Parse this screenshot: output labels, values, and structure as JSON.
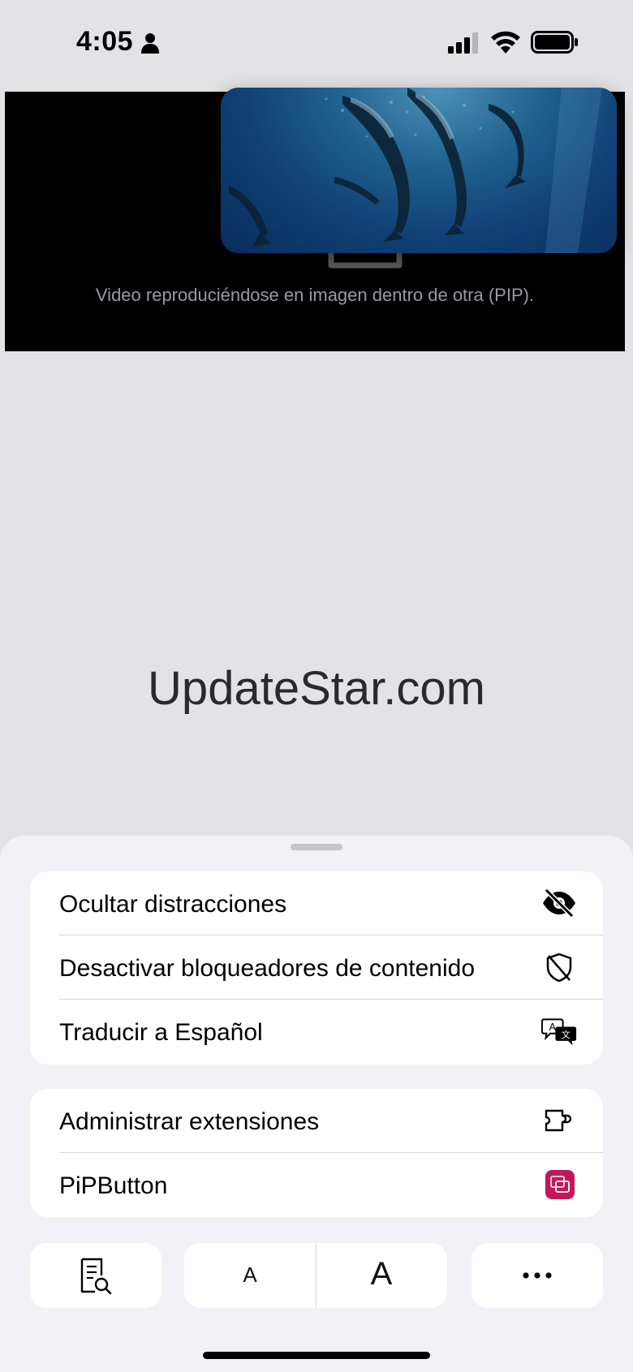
{
  "status_bar": {
    "time": "4:05"
  },
  "video": {
    "caption": "Video reproduciéndose en imagen dentro de otra (PIP)."
  },
  "page": {
    "site_name": "UpdateStar.com"
  },
  "menu": {
    "group_1": [
      {
        "label": "Ocultar distracciones",
        "icon": "eye-slash-icon"
      },
      {
        "label": "Desactivar bloqueadores de contenido",
        "icon": "shield-slash-icon"
      },
      {
        "label": "Traducir a Español",
        "icon": "translate-icon"
      }
    ],
    "group_2": [
      {
        "label": "Administrar extensiones",
        "icon": "puzzle-icon"
      },
      {
        "label": "PiPButton",
        "icon": "pip-extension-icon",
        "icon_color": "#c2185b"
      }
    ]
  },
  "toolbar": {
    "text_smaller": "A",
    "text_larger": "A",
    "reader_icon": "reader-search-icon",
    "more_icon": "more-icon"
  }
}
